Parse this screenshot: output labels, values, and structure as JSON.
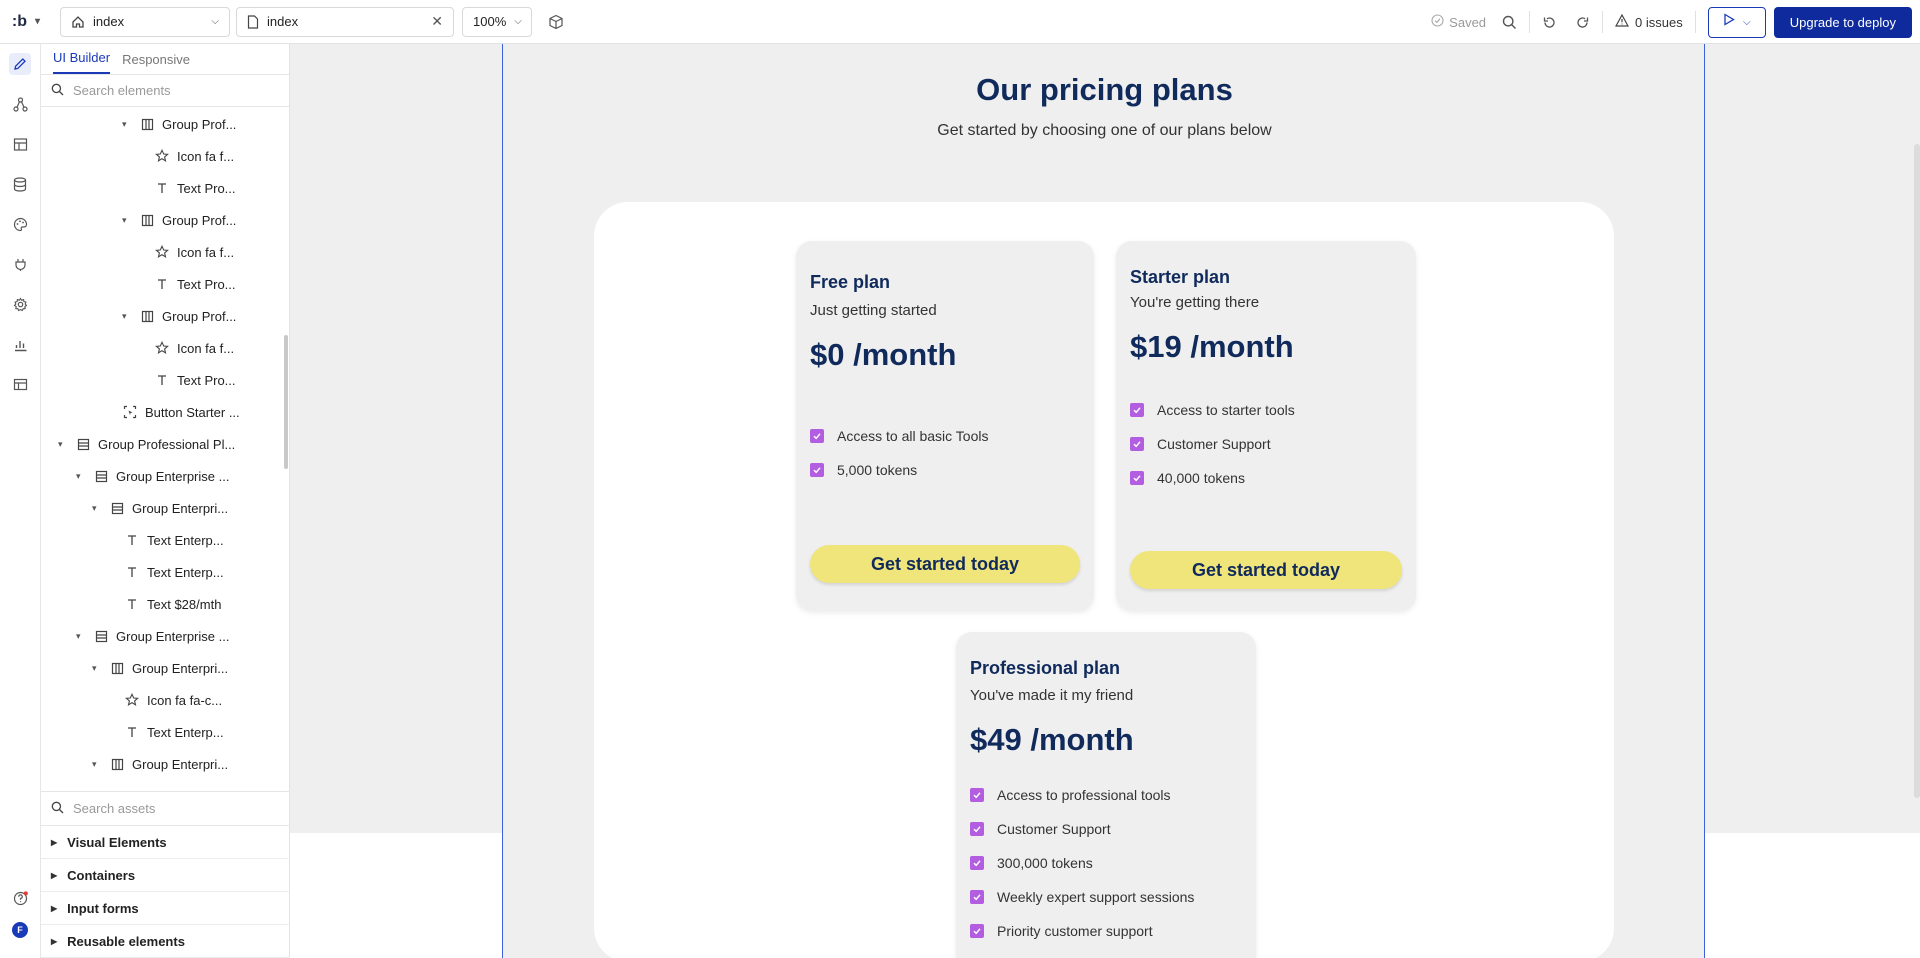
{
  "topbar": {
    "logo": ":b",
    "page_select": "index",
    "tab_name": "index",
    "zoom": "100%",
    "saved": "Saved",
    "issues": "0 issues",
    "deploy": "Upgrade to deploy"
  },
  "panel": {
    "tabs": [
      "UI Builder",
      "Responsive"
    ],
    "search_placeholder": "Search elements",
    "tree": [
      {
        "label": "Group Prof...",
        "icon": "columns-icon",
        "caret": true
      },
      {
        "label": "Icon fa f...",
        "icon": "star-icon",
        "caret": false
      },
      {
        "label": "Text Pro...",
        "icon": "text-icon",
        "caret": false
      },
      {
        "label": "Group Prof...",
        "icon": "columns-icon",
        "caret": true
      },
      {
        "label": "Icon fa f...",
        "icon": "star-icon",
        "caret": false
      },
      {
        "label": "Text Pro...",
        "icon": "text-icon",
        "caret": false
      },
      {
        "label": "Group Prof...",
        "icon": "columns-icon",
        "caret": true
      },
      {
        "label": "Icon fa f...",
        "icon": "star-icon",
        "caret": false
      },
      {
        "label": "Text Pro...",
        "icon": "text-icon",
        "caret": false
      },
      {
        "label": "Button Starter ...",
        "icon": "button-icon",
        "caret": false
      },
      {
        "label": "Group Professional Pl...",
        "icon": "rows-icon",
        "caret": true
      },
      {
        "label": "Group Enterprise ...",
        "icon": "rows-icon",
        "caret": true
      },
      {
        "label": "Group Enterpri...",
        "icon": "rows-icon",
        "caret": true
      },
      {
        "label": "Text Enterp...",
        "icon": "text-icon",
        "caret": false
      },
      {
        "label": "Text Enterp...",
        "icon": "text-icon",
        "caret": false
      },
      {
        "label": "Text $28/mth",
        "icon": "text-icon",
        "caret": false
      },
      {
        "label": "Group Enterprise ...",
        "icon": "rows-icon",
        "caret": true
      },
      {
        "label": "Group Enterpri...",
        "icon": "columns-icon",
        "caret": true
      },
      {
        "label": "Icon fa fa-c...",
        "icon": "star-icon",
        "caret": false
      },
      {
        "label": "Text Enterp...",
        "icon": "text-icon",
        "caret": false
      },
      {
        "label": "Group Enterpri...",
        "icon": "columns-icon",
        "caret": true
      }
    ],
    "assets_placeholder": "Search assets",
    "categories": [
      "Visual Elements",
      "Containers",
      "Input forms",
      "Reusable elements"
    ]
  },
  "canvas": {
    "title": "Our pricing plans",
    "subtitle": "Get started by choosing one of our plans below",
    "plans": [
      {
        "name": "Free plan",
        "tagline": "Just getting started",
        "price": "$0 /month",
        "features": [
          "Access to all basic Tools",
          "5,000 tokens"
        ],
        "cta": "Get started today"
      },
      {
        "name": "Starter plan",
        "tagline": "You're getting there",
        "price": "$19 /month",
        "features": [
          "Access to starter tools",
          "Customer Support",
          "40,000 tokens"
        ],
        "cta": "Get started today"
      },
      {
        "name": "Professional plan",
        "tagline": "You've made it my friend",
        "price": "$49 /month",
        "features": [
          "Access to professional tools",
          "Customer Support",
          "300,000 tokens",
          "Weekly expert support sessions",
          "Priority customer support"
        ]
      }
    ],
    "accent_check": "#b35ee0",
    "cta_color": "#efe57a",
    "heading_color": "#102a5c"
  },
  "user_avatar": "F"
}
